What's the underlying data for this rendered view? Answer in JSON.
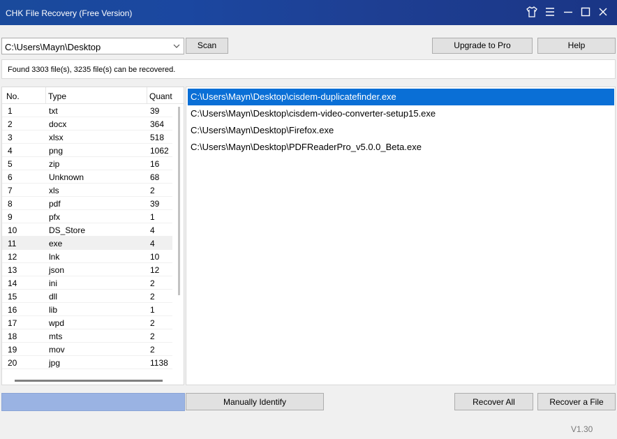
{
  "window": {
    "title": "CHK File Recovery (Free Version)",
    "icons": [
      "shirt-icon",
      "menu-icon",
      "minimize-icon",
      "maximize-icon",
      "close-icon"
    ]
  },
  "toolbar": {
    "path_value": "C:\\Users\\Mayn\\Desktop",
    "scan_label": "Scan",
    "upgrade_label": "Upgrade to Pro",
    "help_label": "Help"
  },
  "status": {
    "text": "Found 3303 file(s), 3235 file(s) can be recovered."
  },
  "type_table": {
    "headers": [
      "No.",
      "Type",
      "Quant"
    ],
    "rows": [
      {
        "no": "1",
        "type": "txt",
        "qty": "39"
      },
      {
        "no": "2",
        "type": "docx",
        "qty": "364"
      },
      {
        "no": "3",
        "type": "xlsx",
        "qty": "518"
      },
      {
        "no": "4",
        "type": "png",
        "qty": "1062"
      },
      {
        "no": "5",
        "type": "zip",
        "qty": "16"
      },
      {
        "no": "6",
        "type": "Unknown",
        "qty": "68"
      },
      {
        "no": "7",
        "type": "xls",
        "qty": "2"
      },
      {
        "no": "8",
        "type": "pdf",
        "qty": "39"
      },
      {
        "no": "9",
        "type": "pfx",
        "qty": "1"
      },
      {
        "no": "10",
        "type": "DS_Store",
        "qty": "4"
      },
      {
        "no": "11",
        "type": "exe",
        "qty": "4"
      },
      {
        "no": "12",
        "type": "lnk",
        "qty": "10"
      },
      {
        "no": "13",
        "type": "json",
        "qty": "12"
      },
      {
        "no": "14",
        "type": "ini",
        "qty": "2"
      },
      {
        "no": "15",
        "type": "dll",
        "qty": "2"
      },
      {
        "no": "16",
        "type": "lib",
        "qty": "1"
      },
      {
        "no": "17",
        "type": "wpd",
        "qty": "2"
      },
      {
        "no": "18",
        "type": "mts",
        "qty": "2"
      },
      {
        "no": "19",
        "type": "mov",
        "qty": "2"
      },
      {
        "no": "20",
        "type": "jpg",
        "qty": "1138"
      }
    ],
    "selected_row": "11"
  },
  "file_list": {
    "items": [
      "C:\\Users\\Mayn\\Desktop\\cisdem-duplicatefinder.exe",
      "C:\\Users\\Mayn\\Desktop\\cisdem-video-converter-setup15.exe",
      "C:\\Users\\Mayn\\Desktop\\Firefox.exe",
      "C:\\Users\\Mayn\\Desktop\\PDFReaderPro_v5.0.0_Beta.exe"
    ],
    "selected_index": 0
  },
  "actions": {
    "manual_label": "Manually Identify",
    "recover_all_label": "Recover All",
    "recover_file_label": "Recover a File"
  },
  "footer": {
    "version": "V1.30"
  },
  "colors": {
    "titlebar": "#1b47a0",
    "selection": "#0a6fd6",
    "progress": "#9ab3e3"
  }
}
